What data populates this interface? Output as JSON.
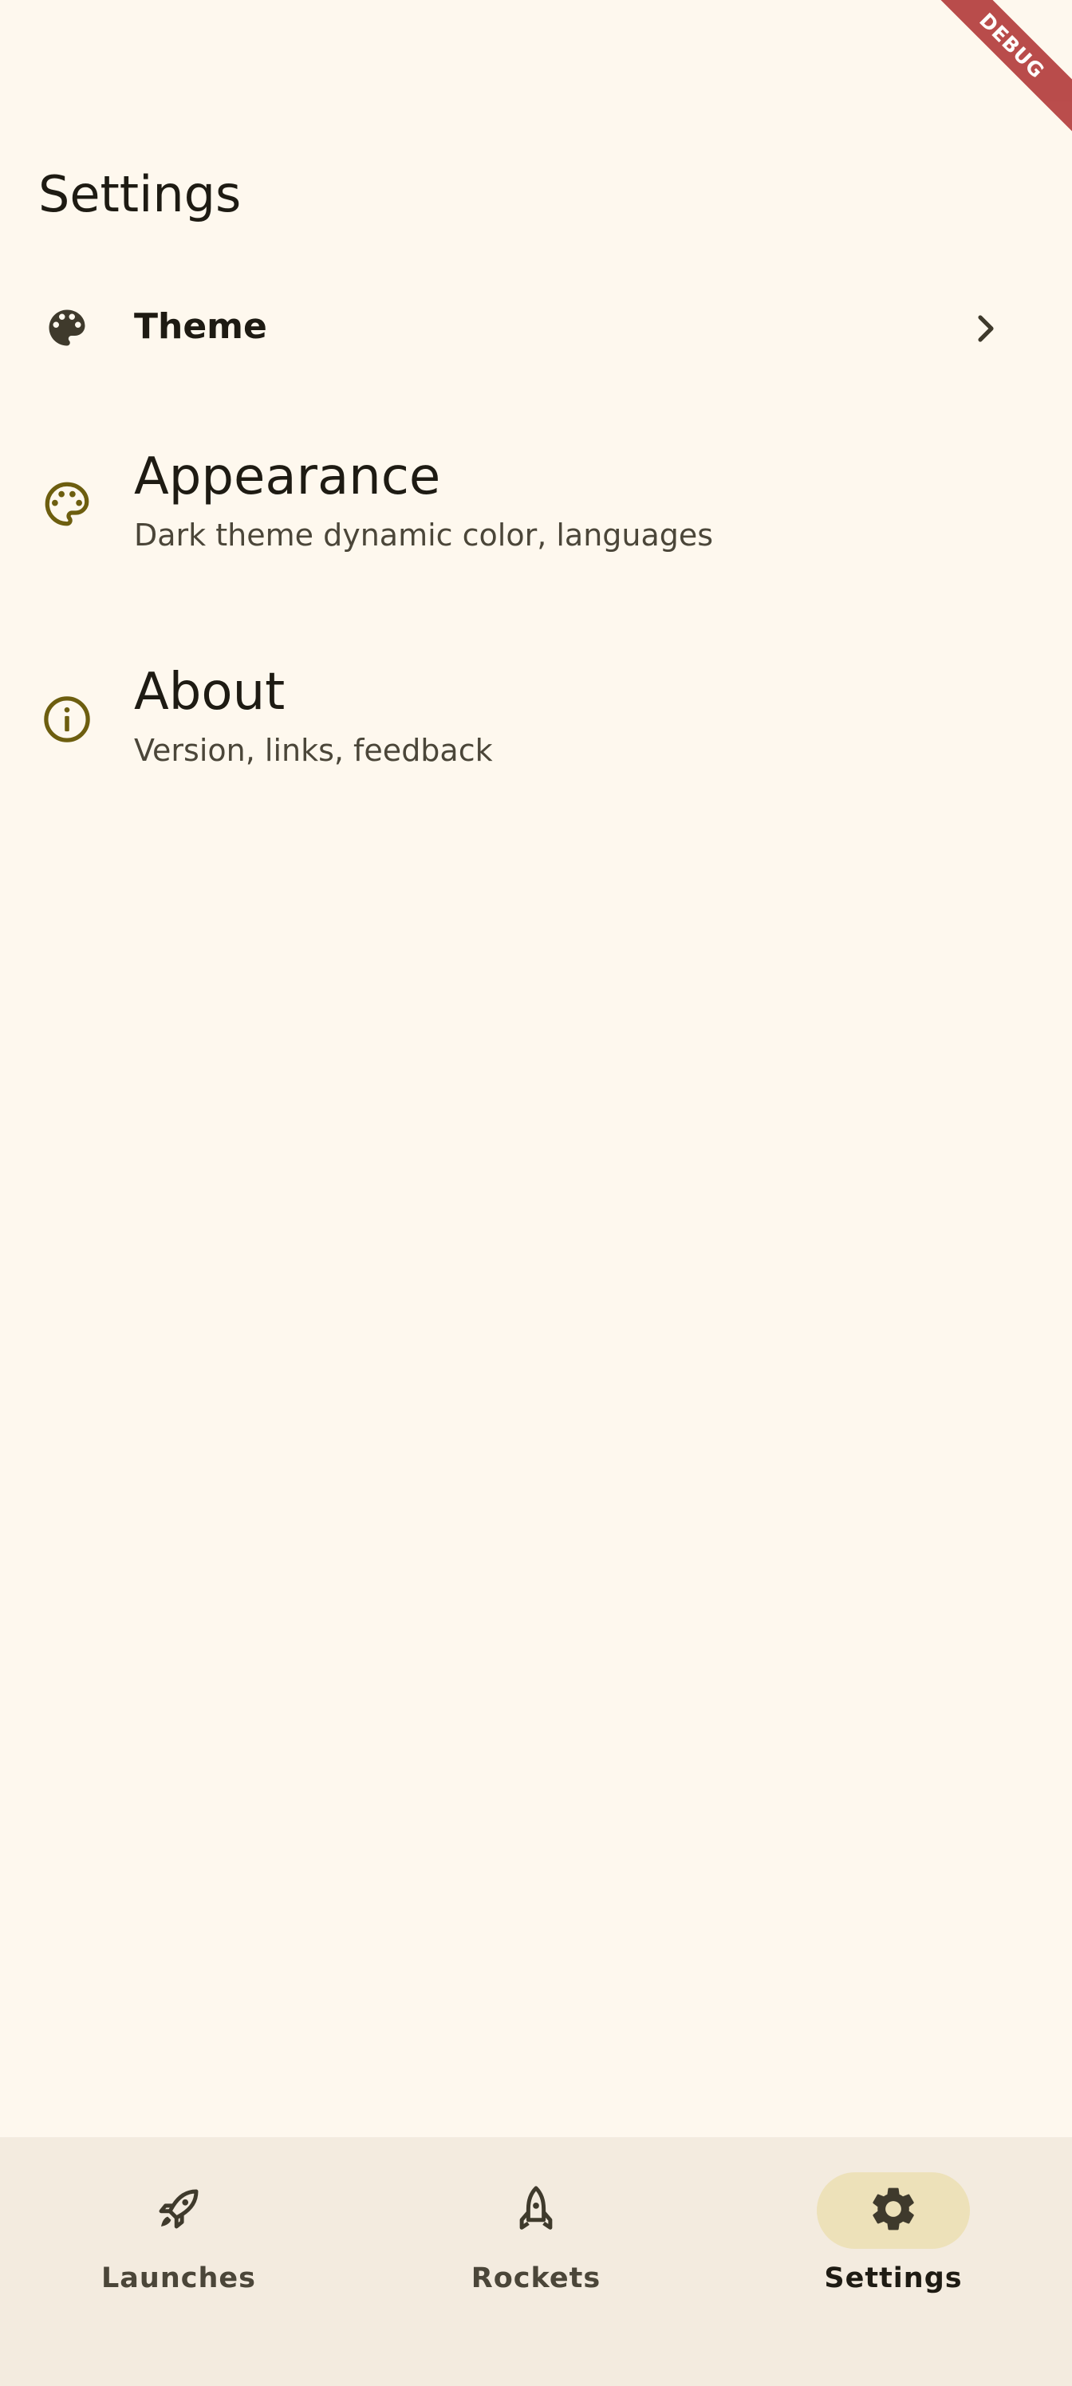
{
  "debug_banner": "DEBUG",
  "page": {
    "title": "Settings"
  },
  "settings": {
    "theme": {
      "label": "Theme",
      "icon": "palette-filled-icon"
    },
    "appearance": {
      "title": "Appearance",
      "subtitle": "Dark theme dynamic color, languages",
      "icon": "palette-outline-icon"
    },
    "about": {
      "title": "About",
      "subtitle": "Version, links, feedback",
      "icon": "info-outline-icon"
    }
  },
  "bottom_nav": {
    "items": [
      {
        "label": "Launches",
        "icon": "rocket-launch-icon",
        "active": false
      },
      {
        "label": "Rockets",
        "icon": "rocket-icon",
        "active": false
      },
      {
        "label": "Settings",
        "icon": "gear-icon",
        "active": true
      }
    ]
  },
  "colors": {
    "background": "#FEF8EE",
    "nav_background": "#F3EBDF",
    "accent_icon": "#6D5E0F",
    "active_pill": "#EDE1B9",
    "debug_ribbon": "#B23A3A"
  }
}
